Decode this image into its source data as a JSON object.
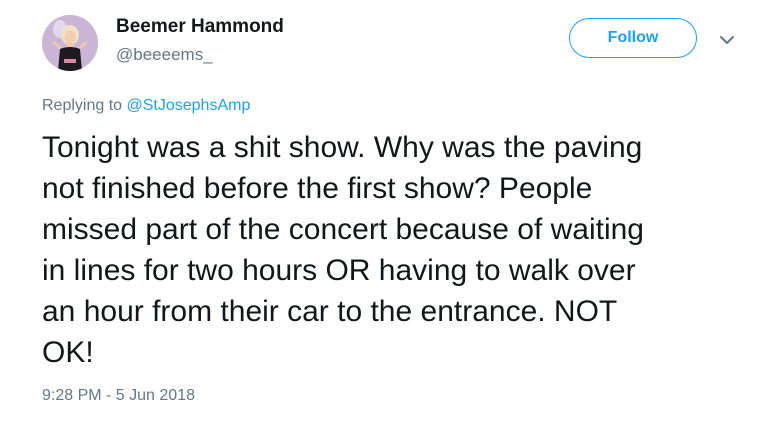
{
  "user": {
    "display_name": "Beemer Hammond",
    "handle": "@beeeems_"
  },
  "actions": {
    "follow_label": "Follow",
    "menu_icon": "chevron-down-icon"
  },
  "reply": {
    "prefix": "Replying to ",
    "mention": "@StJosephsAmp"
  },
  "tweet": {
    "text": "Tonight was a shit show. Why was the paving\nnot finished before the first show? People\nmissed part of the concert because of waiting\nin lines for two hours OR having to walk over\nan hour from their car to the entrance. NOT\nOK!",
    "timestamp": "9:28 PM - 5 Jun 2018"
  },
  "colors": {
    "accent": "#1da1f2",
    "secondary_text": "#657786",
    "primary_text": "#14171a"
  }
}
